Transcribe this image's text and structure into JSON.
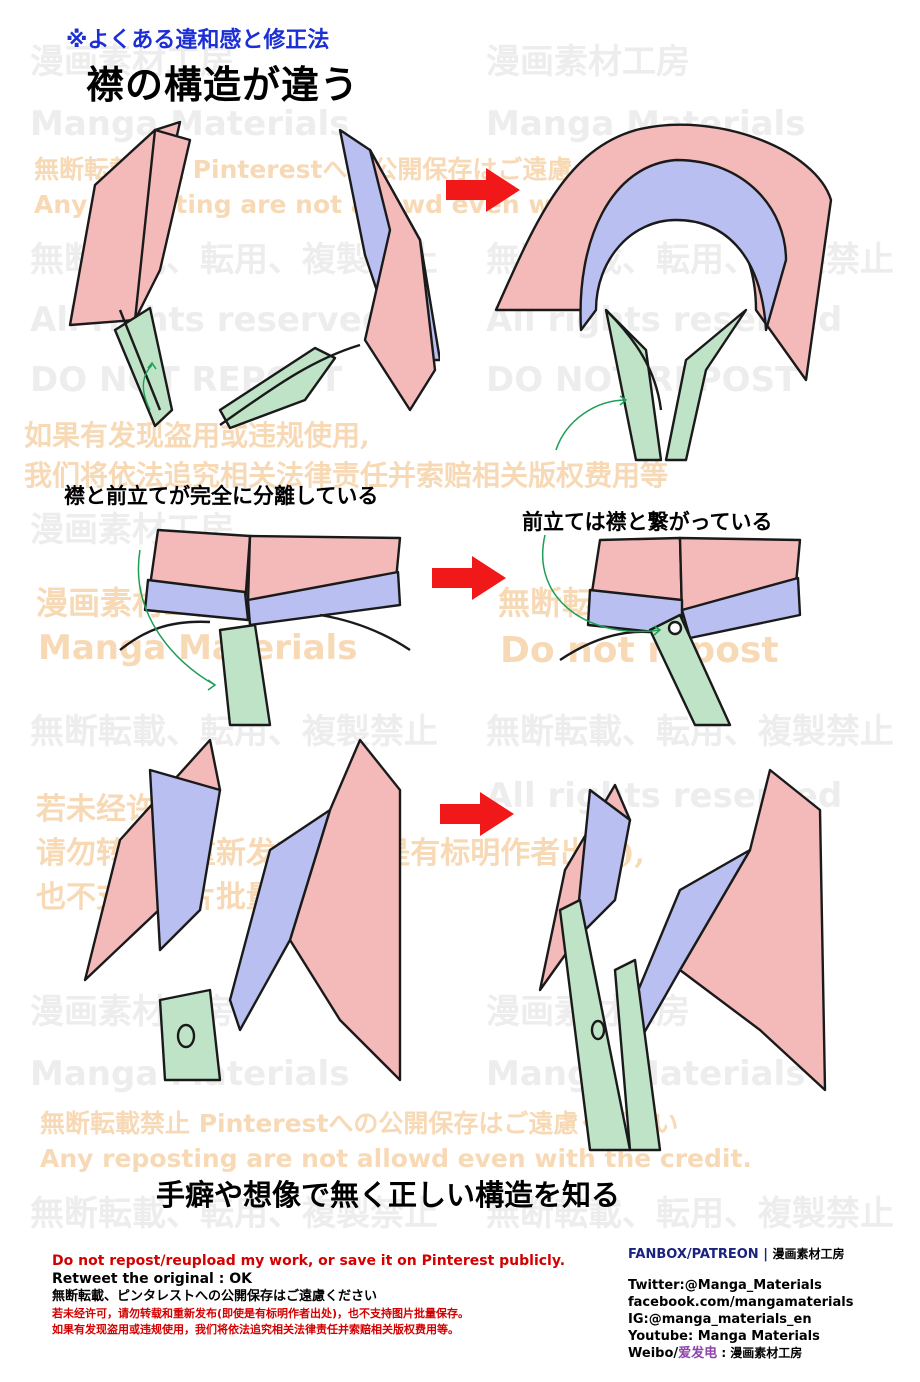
{
  "header": {
    "subtitle": "※よくある違和感と修正法",
    "title": "襟の構造が違う"
  },
  "watermarks": {
    "studio_jp": "漫画素材工房",
    "manga_materials": "Manga Materials",
    "no_repost_pinterest_jp": "無断転載禁止 Pinterestへの公開保存はご遠慮ください",
    "no_repost_credit_en": "Any reposting are not allowd even with the credit.",
    "no_repost_jp": "無断転載、転用、複製禁止",
    "all_rights": "All rights reserved",
    "do_not_repost": "DO NOT REPOST",
    "cn_line1": "如果有发现盗用或违规使用,",
    "cn_line2": "我们将依法追究相关法律责任并索赔相关版权费用等",
    "no_repost_short_jp": "漫画素材工房",
    "do_not_repost_lower": "Do not repost",
    "no_repost_ban_jp": "無断転載禁止",
    "cn2_line1": "若未经许可,",
    "cn2_line2": "请勿转载和重新发布(即使是有标明作者出处),",
    "cn2_line3": "也不支持图片批量保存。"
  },
  "captions": {
    "separated": "襟と前立てが完全に分離している",
    "connected": "前立ては襟と繋がっている",
    "conclusion": "手癖や想像で無く正しい構造を知る"
  },
  "footer": {
    "left": {
      "line1": "Do not repost/reupload my work, or save it on Pinterest publicly.",
      "line2": "Retweet the original : OK",
      "line3": "無断転載、ピンタレストへの公開保存はご遠慮ください",
      "line4": "若未经许可，请勿转载和重新发布(即使是有标明作者出处)，也不支持图片批量保存。",
      "line5": "如果有发现盗用或违规使用，我们将依法追究相关法律责任并索赔相关版权费用等。"
    },
    "right": {
      "fanbox": "FANBOX/PATREON",
      "separator": " | ",
      "studio": "漫画素材工房",
      "twitter": "Twitter:@Manga_Materials",
      "facebook": "facebook.com/mangamaterials",
      "instagram": "IG:@manga_materials_en",
      "youtube": "Youtube: Manga Materials",
      "weibo_prefix": "Weibo/",
      "weibo_aifadian": "爱发电",
      "weibo_suffix": " : 漫画素材工房"
    }
  },
  "colors": {
    "collar_pink": "#f4b9b9",
    "band_blue": "#b9bff0",
    "placket_green": "#bfe3c6",
    "arrow_red": "#f01818",
    "subtitle_blue": "#1c2fd6",
    "footer_red": "#d40000",
    "footer_navy": "#1a237e",
    "weibo_purple": "#8e44ad"
  }
}
